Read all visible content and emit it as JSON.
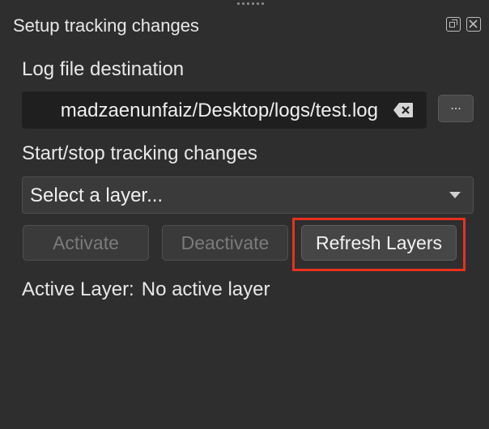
{
  "panel": {
    "title": "Setup tracking changes",
    "icons": {
      "float": "float-window-icon",
      "close": "close-window-icon",
      "grip": "drag-grip-icon"
    }
  },
  "log_file": {
    "label": "Log file destination",
    "path_value": "madzaenunfaiz/Desktop/logs/test.log",
    "clear_icon": "clear-text-icon",
    "browse_label": "..."
  },
  "tracking": {
    "label": "Start/stop tracking changes",
    "layer_select": {
      "selected": "Select a layer...",
      "icon": "chevron-down-icon"
    },
    "buttons": {
      "activate": "Activate",
      "deactivate": "Deactivate",
      "refresh": "Refresh Layers"
    }
  },
  "status": {
    "active_layer_label": "Active Layer:",
    "active_layer_value": "No active layer"
  },
  "colors": {
    "background": "#2e2e2e",
    "field_dark": "#1f1f1f",
    "text": "#e8e8e8",
    "disabled_text": "#7b7b7b",
    "highlight": "#e8311f"
  }
}
